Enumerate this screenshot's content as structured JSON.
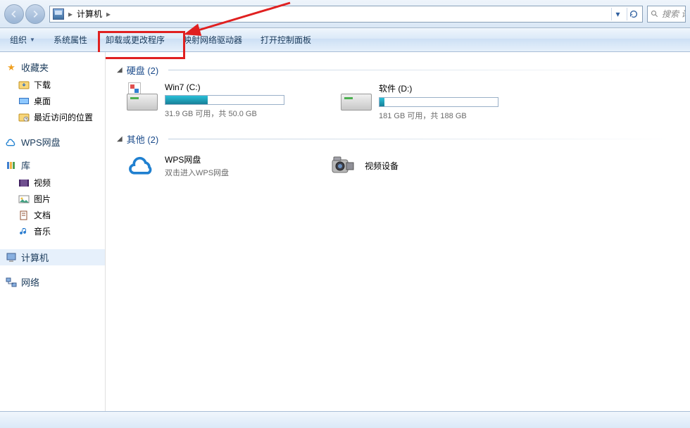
{
  "addressbar": {
    "crumb1": "计算机",
    "back_dropdown": "▾",
    "refresh": "↻"
  },
  "search": {
    "placeholder": "搜索 计"
  },
  "toolbar": {
    "organize": "组织",
    "sys_props": "系统属性",
    "uninstall": "卸载或更改程序",
    "map_drive": "映射网络驱动器",
    "control_panel": "打开控制面板"
  },
  "sidebar": {
    "favorites": "收藏夹",
    "downloads": "下载",
    "desktop": "桌面",
    "recent": "最近访问的位置",
    "wps": "WPS网盘",
    "library": "库",
    "videos": "视频",
    "pictures": "图片",
    "documents": "文档",
    "music": "音乐",
    "computer": "计算机",
    "network": "网络"
  },
  "content": {
    "section_hdd": "硬盘 (2)",
    "section_other": "其他 (2)",
    "drives": [
      {
        "label": "Win7 (C:)",
        "stats": "31.9 GB 可用，共 50.0 GB",
        "fill_pct": 36
      },
      {
        "label": "软件 (D:)",
        "stats": "181 GB 可用，共 188 GB",
        "fill_pct": 4
      }
    ],
    "others": {
      "wps_label": "WPS网盘",
      "wps_sub": "双击进入WPS网盘",
      "video_label": "视频设备"
    }
  }
}
